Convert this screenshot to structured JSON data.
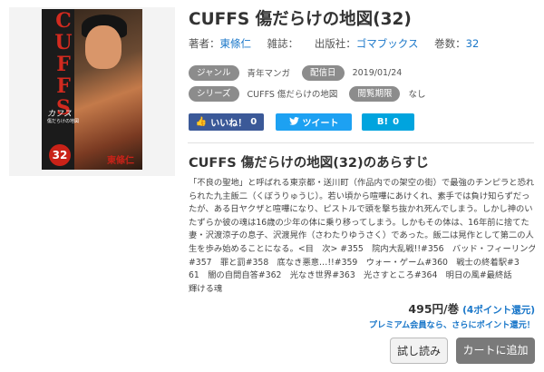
{
  "cover": {
    "title_text": "CUFFS",
    "katakana": "カフス",
    "subtitle_small": "傷だらけの地図",
    "volume": "32",
    "author": "東條仁"
  },
  "title": "CUFFS 傷だらけの地図(32)",
  "meta": {
    "author_label": "著者：",
    "author": "東條仁",
    "magazine_label": "雑誌：",
    "publisher_label": "出版社：",
    "publisher": "ゴマブックス",
    "volumes_label": "巻数：",
    "volumes": "32"
  },
  "tags": {
    "genre_label": "ジャンル",
    "genre": "青年マンガ",
    "date_label": "配信日",
    "date": "2019/01/24",
    "series_label": "シリーズ",
    "series": "CUFFS 傷だらけの地図",
    "period_label": "閲覧期限",
    "period": "なし"
  },
  "social": {
    "facebook_label": "いいね！",
    "facebook_count": "0",
    "twitter_label": "ツイート",
    "hatena_label": "B!",
    "hatena_count": "0"
  },
  "synopsis_title": "CUFFS 傷だらけの地図(32)のあらすじ",
  "synopsis_lines": [
    "「不良の聖地」と呼ばれる東京都・送川町（作品内での架空の街）で最強のチンピラと恐れ",
    "られた九主飯二（くぼうりゅうじ）。若い頃から喧嘩にあけくれ、素手では負け知らずだっ",
    "たが、ある日ヤクザと喧嘩になり、ピストルで頭を撃ち抜かれ死んでしまう。しかし神のい",
    "たずらか彼の魂は16歳の少年の体に乗り移ってしまう。しかもその体は、16年前に捨てた",
    "妻・沢渡涼子の息子、沢渡晃作（さわたりゆうさく）であった。飯二は晃作として第二の人",
    "生を歩み始めることになる。<目　次> #355　院内大乱戦!!#356　バッド・フィーリング",
    "#357　罪と罰#358　底なき悪意…!!#359　ウォー・ゲーム#360　戦士の終着駅#3",
    "61　闇の自問自答#362　光なき世界#363　光さすところ#364　明日の風#最終話",
    "輝ける魂"
  ],
  "price": {
    "amount": "495円/巻",
    "points": "(4ポイント還元)",
    "premium_note": "プレミアム会員なら、さらにポイント還元！"
  },
  "buttons": {
    "trial": "試し読み",
    "cart": "カートに追加"
  }
}
